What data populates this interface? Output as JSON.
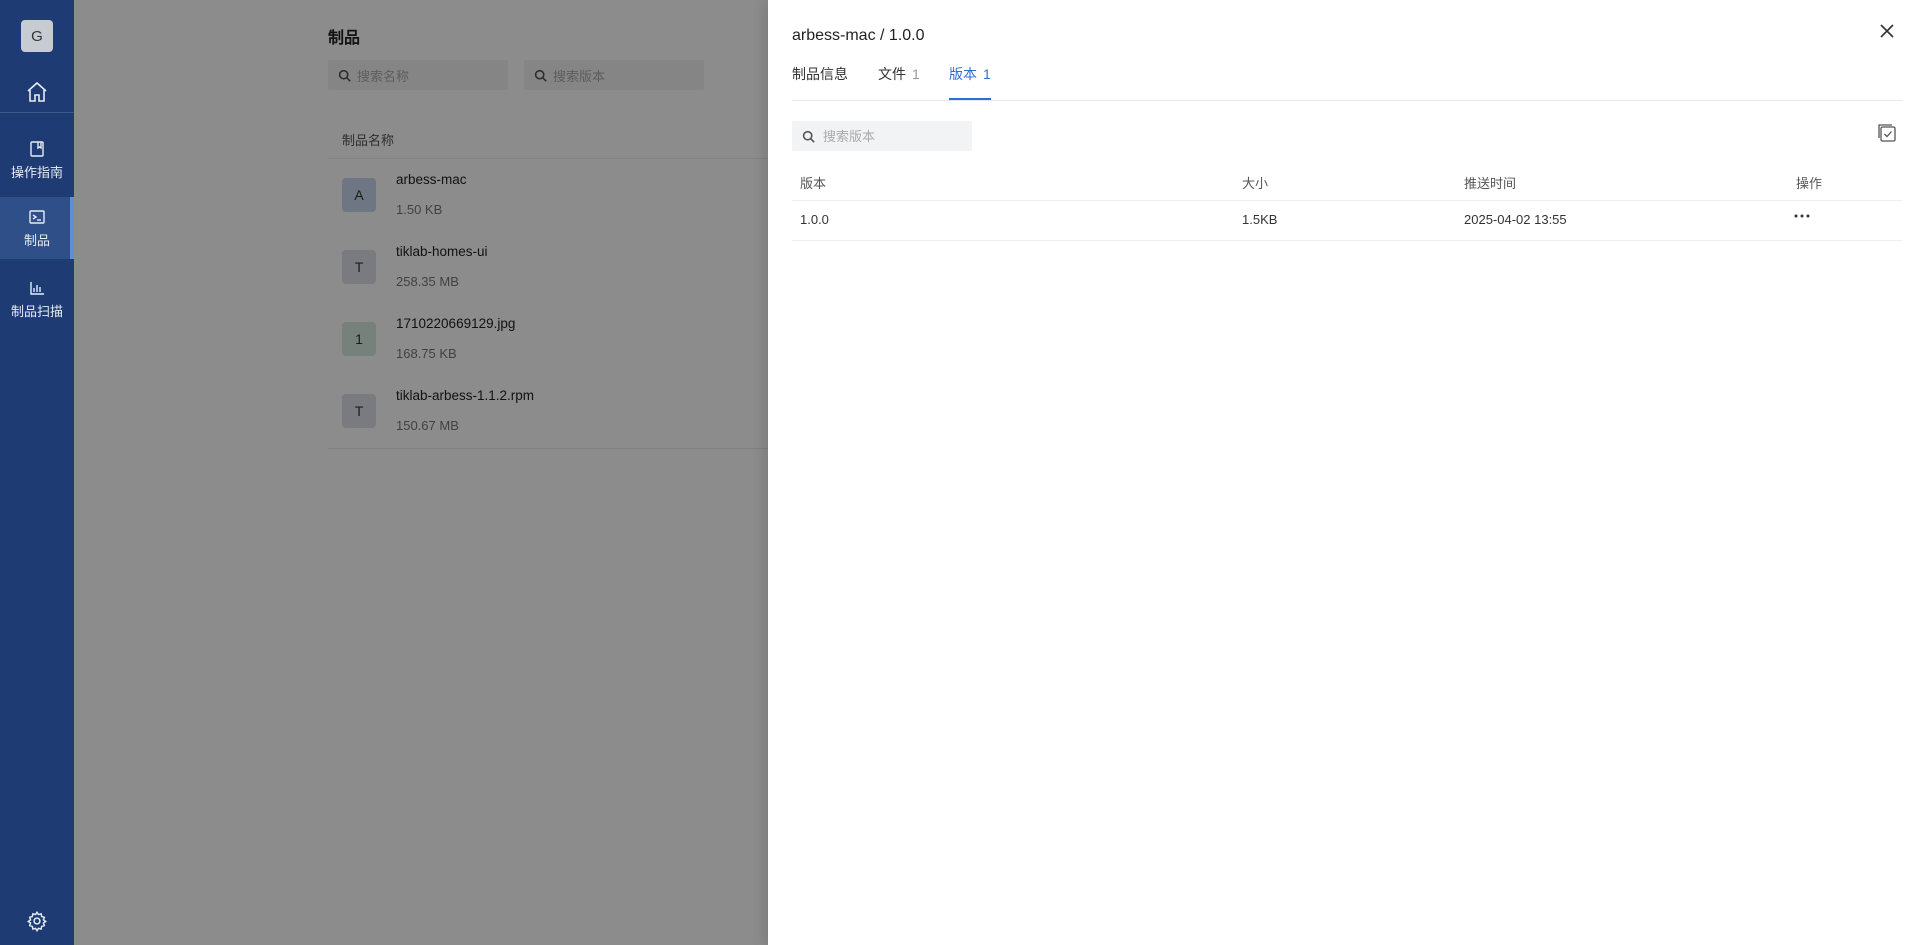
{
  "sidebar": {
    "avatar_letter": "G",
    "items": [
      {
        "label": "操作指南",
        "icon": "book-icon"
      },
      {
        "label": "制品",
        "icon": "terminal-icon",
        "active": true
      },
      {
        "label": "制品扫描",
        "icon": "bar-chart-icon"
      }
    ],
    "bg_color": "#1f3b73"
  },
  "page": {
    "title": "制品",
    "search_name_placeholder": "搜索名称",
    "search_version_placeholder": "搜索版本",
    "table_header": "制品名称",
    "rows": [
      {
        "letter": "A",
        "name": "arbess-mac",
        "size": "1.50 KB",
        "color": "#c9d7ef"
      },
      {
        "letter": "T",
        "name": "tiklab-homes-ui",
        "size": "258.35 MB",
        "color": "#dfe1ea"
      },
      {
        "letter": "1",
        "name": "1710220669129.jpg",
        "size": "168.75 KB",
        "color": "#d6ecdf"
      },
      {
        "letter": "T",
        "name": "tiklab-arbess-1.1.2.rpm",
        "size": "150.67 MB",
        "color": "#dfe1ea"
      }
    ]
  },
  "drawer": {
    "title": "arbess-mac / 1.0.0",
    "tabs": [
      {
        "label": "制品信息",
        "count": ""
      },
      {
        "label": "文件",
        "count": "1"
      },
      {
        "label": "版本",
        "count": "1",
        "active": true
      }
    ],
    "search_placeholder": "搜索版本",
    "columns": [
      "版本",
      "大小",
      "推送时间",
      "操作"
    ],
    "versions": [
      {
        "version": "1.0.0",
        "size": "1.5KB",
        "pushed": "2025-04-02 13:55"
      }
    ],
    "accent": "#2f6fd0"
  }
}
